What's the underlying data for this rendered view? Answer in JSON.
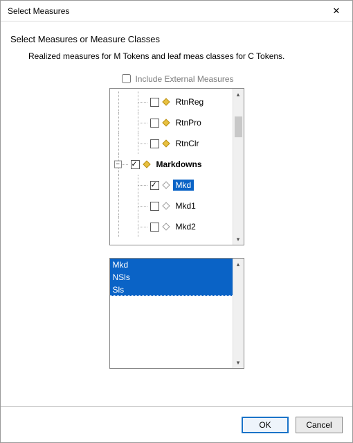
{
  "window": {
    "title": "Select Measures"
  },
  "heading": "Select Measures or Measure Classes",
  "subheading": "Realized measures for M Tokens and leaf meas classes for C Tokens.",
  "include_external": {
    "label": "Include External Measures",
    "checked": false
  },
  "tree": {
    "items": [
      {
        "label": "RtnReg",
        "checked": false,
        "diamond": "yellow",
        "depth": 2,
        "selected": false,
        "bold": false,
        "expander": null
      },
      {
        "label": "RtnPro",
        "checked": false,
        "diamond": "yellow",
        "depth": 2,
        "selected": false,
        "bold": false,
        "expander": null
      },
      {
        "label": "RtnClr",
        "checked": false,
        "diamond": "yellow",
        "depth": 2,
        "selected": false,
        "bold": false,
        "expander": null
      },
      {
        "label": "Markdowns",
        "checked": true,
        "diamond": "yellow",
        "depth": 1,
        "selected": false,
        "bold": true,
        "expander": "minus"
      },
      {
        "label": "Mkd",
        "checked": true,
        "diamond": "hollow",
        "depth": 2,
        "selected": true,
        "bold": false,
        "expander": null
      },
      {
        "label": "Mkd1",
        "checked": false,
        "diamond": "hollow",
        "depth": 2,
        "selected": false,
        "bold": false,
        "expander": null
      },
      {
        "label": "Mkd2",
        "checked": false,
        "diamond": "hollow",
        "depth": 2,
        "selected": false,
        "bold": false,
        "expander": null
      }
    ]
  },
  "selected_list": {
    "items": [
      {
        "label": "Mkd",
        "selected": true,
        "last": false
      },
      {
        "label": "NSls",
        "selected": true,
        "last": false
      },
      {
        "label": "Sls",
        "selected": true,
        "last": true
      }
    ]
  },
  "buttons": {
    "ok": "OK",
    "cancel": "Cancel"
  }
}
